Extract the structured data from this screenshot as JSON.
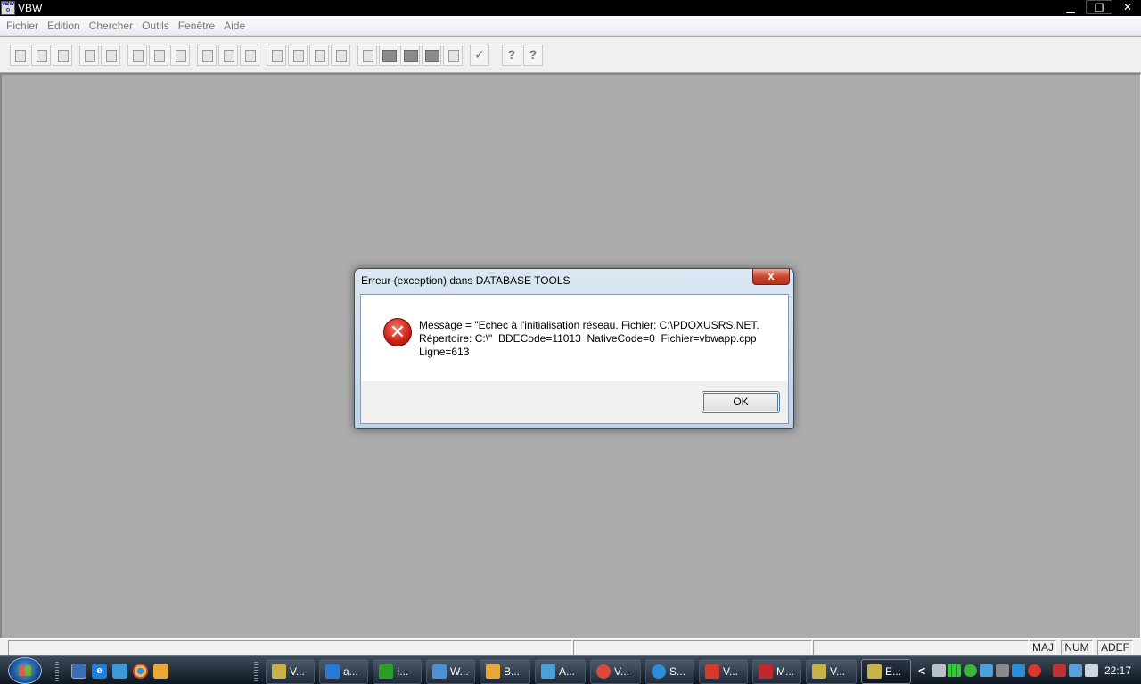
{
  "window": {
    "title": "VBW",
    "app_icon": "vbw-app-icon",
    "minimize_glyph": "▁",
    "restore_glyph": "❐",
    "close_glyph": "✕"
  },
  "menu": [
    "Fichier",
    "Edition",
    "Chercher",
    "Outils",
    "Fenêtre",
    "Aide"
  ],
  "toolbar": {
    "help_glyph": "?",
    "context_help_glyph": "?",
    "check_glyph": "✓"
  },
  "dialog": {
    "title": "Erreur (exception) dans DATABASE TOOLS",
    "close_glyph": "x",
    "icon": "error-icon",
    "icon_glyph": "✕",
    "message_lines": [
      "Message = \"Echec à l'initialisation réseau. Fichier: C:\\PDOXUSRS.NET.",
      "Répertoire: C:\\\"  BDECode=11013  NativeCode=0  Fichier=vbwapp.cpp",
      "Ligne=613"
    ],
    "ok_label": "OK"
  },
  "statusbar": {
    "maj": "MAJ",
    "num": "NUM",
    "adef": "ADEF"
  },
  "taskbar": {
    "tasks": [
      {
        "label": "V...",
        "icon": "vbw-task-icon",
        "color": "#c9b14a"
      },
      {
        "label": "a...",
        "icon": "ie-task-icon",
        "color": "#2a79d6"
      },
      {
        "label": "I...",
        "icon": "flag-task-icon",
        "color": "#28a028"
      },
      {
        "label": "W...",
        "icon": "network-task-icon",
        "color": "#4f8fd8"
      },
      {
        "label": "B...",
        "icon": "messenger-task-icon",
        "color": "#e8a93a"
      },
      {
        "label": "A...",
        "icon": "users-task-icon",
        "color": "#4aa0d8"
      },
      {
        "label": "V...",
        "icon": "chrome-task-icon",
        "color": "#d94a3a"
      },
      {
        "label": "S...",
        "icon": "skype-task-icon",
        "color": "#2a8fd8"
      },
      {
        "label": "V...",
        "icon": "pdf-task-icon",
        "color": "#d83a2a"
      },
      {
        "label": "M...",
        "icon": "flag-uk-task-icon",
        "color": "#c0282d"
      },
      {
        "label": "V...",
        "icon": "vbw-task-icon",
        "color": "#c9b14a"
      },
      {
        "label": "E...",
        "icon": "vbw-task-icon",
        "color": "#c9b14a",
        "active": true
      }
    ],
    "tray_arrow": "<",
    "clock": "22:17"
  }
}
